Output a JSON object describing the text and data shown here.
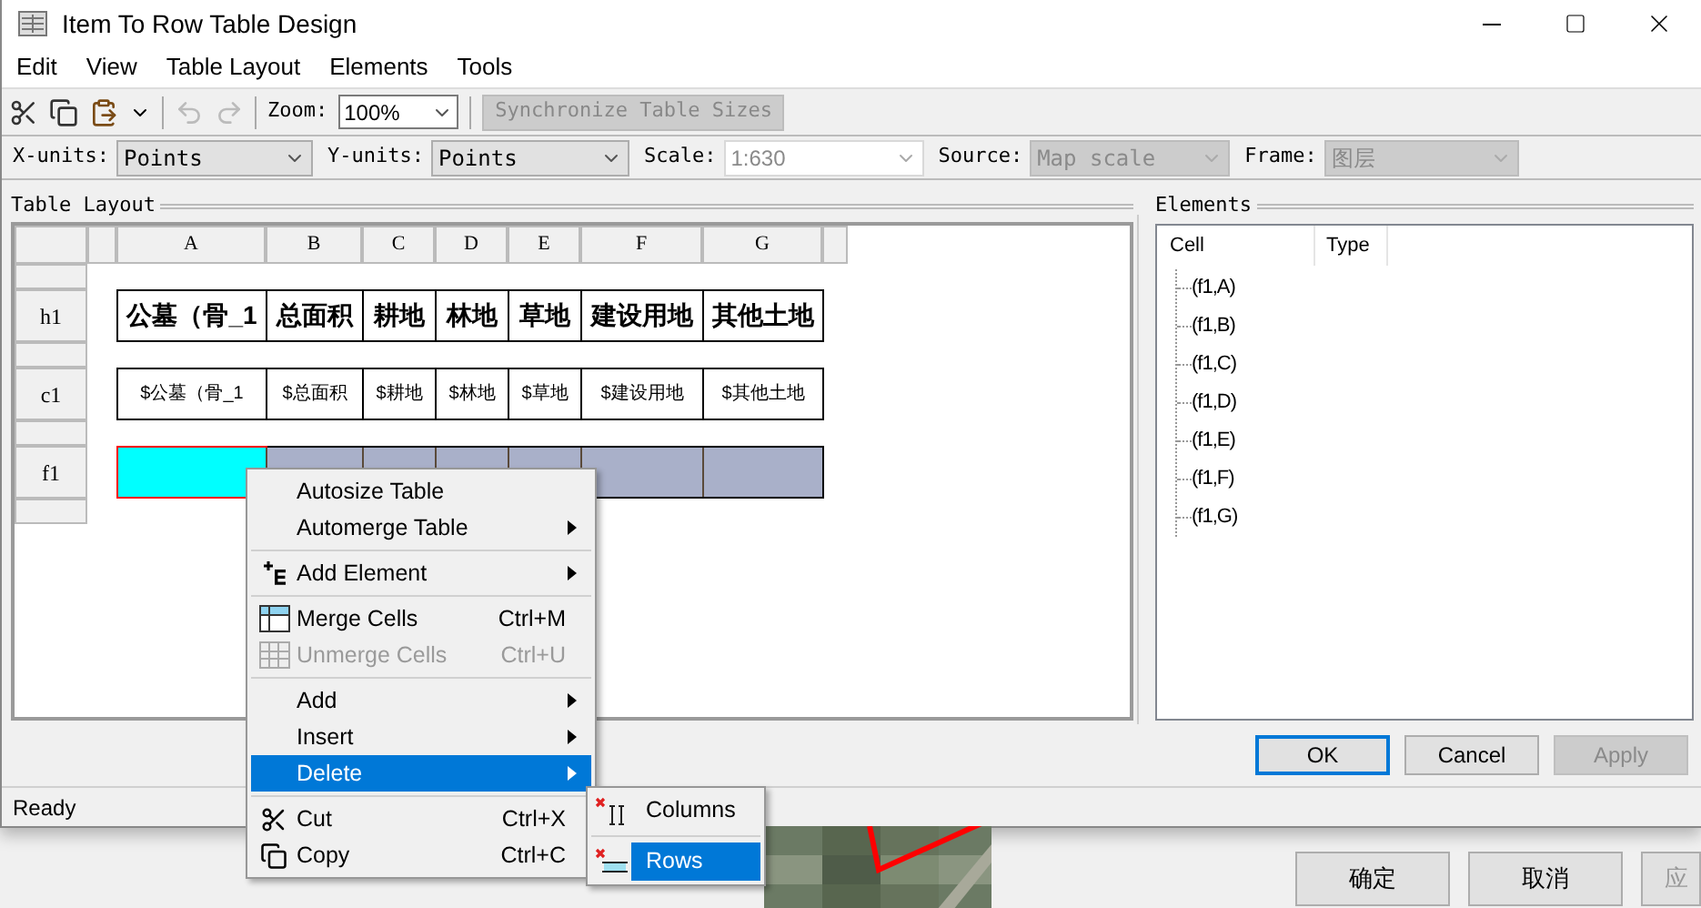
{
  "window": {
    "title": "Item To Row Table Design"
  },
  "menu": [
    "Edit",
    "View",
    "Table Layout",
    "Elements",
    "Tools"
  ],
  "toolbar": {
    "zoom_label": "Zoom:",
    "zoom_value": "100%",
    "sync_button": {
      "label": "Synchronize Table Sizes",
      "disabled": true
    }
  },
  "units": [
    {
      "label": "X-units:",
      "value": "Points",
      "kind": "combo",
      "disabled": false
    },
    {
      "label": "Y-units:",
      "value": "Points",
      "kind": "combo",
      "disabled": false
    },
    {
      "label": "Scale:",
      "value": "1:630",
      "kind": "edit-combo",
      "disabled": true
    },
    {
      "label": "Source:",
      "value": "Map scale",
      "kind": "combo",
      "disabled": true
    },
    {
      "label": "Frame:",
      "value": "图层",
      "kind": "combo",
      "disabled": true
    }
  ],
  "table_layout": {
    "title": "Table Layout",
    "columns": [
      "A",
      "B",
      "C",
      "D",
      "E",
      "F",
      "G"
    ],
    "rows": [
      {
        "label": "h1",
        "kind": "header",
        "cells": [
          "公墓（骨_1",
          "总面积",
          "耕地",
          "林地",
          "草地",
          "建设用地",
          "其他土地"
        ]
      },
      {
        "label": "c1",
        "kind": "content",
        "cells": [
          "$公墓（骨_1",
          "$总面积",
          "$耕地",
          "$林地",
          "$草地",
          "$建设用地",
          "$其他土地"
        ]
      },
      {
        "label": "f1",
        "kind": "field",
        "cells": [
          {
            "selected": true
          },
          {
            "selected": false
          },
          {
            "selected": false
          },
          {
            "selected": false
          },
          {
            "selected": false
          },
          {
            "selected": false
          },
          {
            "selected": false
          }
        ]
      }
    ]
  },
  "elements": {
    "title": "Elements",
    "columns": [
      "Cell",
      "Type"
    ],
    "items": [
      "(f1,A)",
      "(f1,B)",
      "(f1,C)",
      "(f1,D)",
      "(f1,E)",
      "(f1,F)",
      "(f1,G)"
    ]
  },
  "buttons": [
    {
      "label": "OK",
      "focused": true,
      "disabled": false
    },
    {
      "label": "Cancel",
      "focused": false,
      "disabled": false
    },
    {
      "label": "Apply",
      "focused": false,
      "disabled": true
    }
  ],
  "status_bar": "Ready",
  "context_menu": [
    {
      "kind": "item",
      "label": "Autosize Table",
      "submenu": false,
      "disabled": false,
      "selected": false
    },
    {
      "kind": "item",
      "label": "Automerge Table",
      "submenu": true,
      "disabled": false,
      "selected": false
    },
    {
      "kind": "separator"
    },
    {
      "kind": "item",
      "label": "Add Element",
      "submenu": true,
      "disabled": false,
      "selected": false
    },
    {
      "kind": "separator"
    },
    {
      "kind": "item",
      "label": "Merge Cells",
      "shortcut": "Ctrl+M",
      "submenu": false,
      "disabled": false,
      "selected": false
    },
    {
      "kind": "item",
      "label": "Unmerge Cells",
      "shortcut": "Ctrl+U",
      "submenu": false,
      "disabled": true,
      "selected": false
    },
    {
      "kind": "separator"
    },
    {
      "kind": "item",
      "label": "Add",
      "submenu": true,
      "disabled": false,
      "selected": false
    },
    {
      "kind": "item",
      "label": "Insert",
      "submenu": true,
      "disabled": false,
      "selected": false
    },
    {
      "kind": "item",
      "label": "Delete",
      "submenu": true,
      "disabled": false,
      "selected": true
    },
    {
      "kind": "separator"
    },
    {
      "kind": "item",
      "label": "Cut",
      "shortcut": "Ctrl+X",
      "submenu": false,
      "disabled": false,
      "selected": false
    },
    {
      "kind": "item",
      "label": "Copy",
      "shortcut": "Ctrl+C",
      "submenu": false,
      "disabled": false,
      "selected": false
    }
  ],
  "submenu": [
    {
      "label": "Columns",
      "selected": false
    },
    {
      "label": "Rows",
      "selected": true
    }
  ],
  "background": {
    "buttons": [
      "确定",
      "取消",
      "应"
    ]
  }
}
